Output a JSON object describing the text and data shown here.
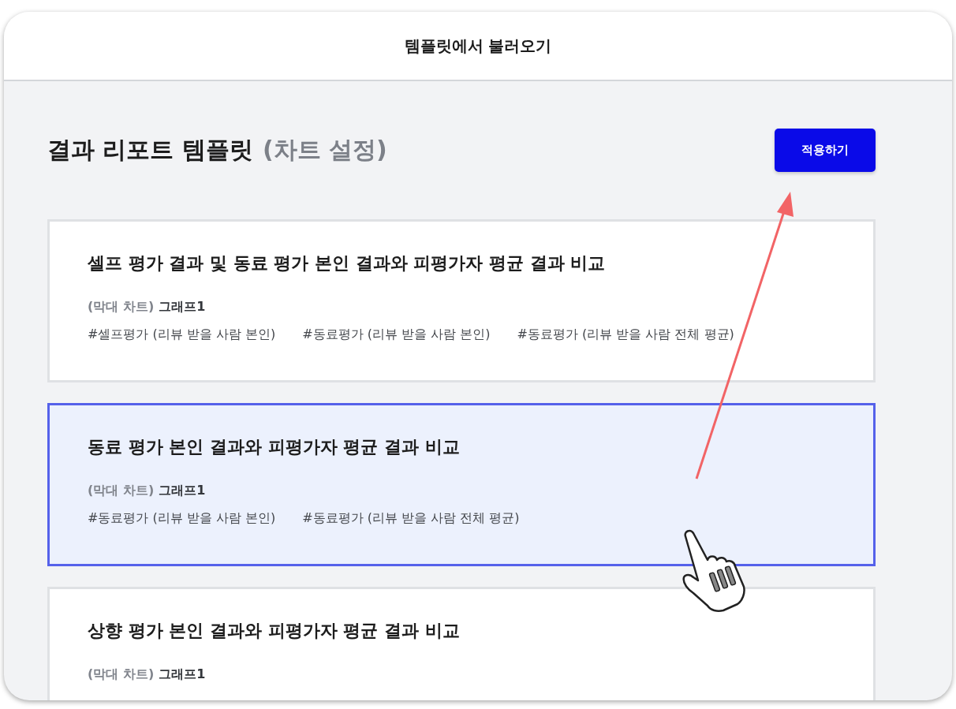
{
  "header": {
    "title": "템플릿에서 불러오기"
  },
  "page_title": {
    "main": "결과 리포트 템플릿",
    "sub": "(차트 설정)"
  },
  "apply_button": "적용하기",
  "templates": [
    {
      "title": "셀프 평가 결과 및 동료 평가 본인 결과와 피평가자 평균 결과 비교",
      "chart_type": "(막대 차트)",
      "chart_name": "그래프1",
      "tags": [
        "#셀프평가 (리뷰 받을 사람 본인)",
        "#동료평가 (리뷰 받을 사람 본인)",
        "#동료평가 (리뷰 받을 사람 전체 평균)"
      ],
      "selected": false
    },
    {
      "title": "동료 평가 본인 결과와 피평가자 평균 결과 비교",
      "chart_type": "(막대 차트)",
      "chart_name": "그래프1",
      "tags": [
        "#동료평가 (리뷰 받을 사람 본인)",
        "#동료평가 (리뷰 받을 사람 전체 평균)"
      ],
      "selected": true
    },
    {
      "title": "상향 평가 본인 결과와 피평가자 평균 결과 비교",
      "chart_type": "(막대 차트)",
      "chart_name": "그래프1",
      "selected": false
    }
  ]
}
